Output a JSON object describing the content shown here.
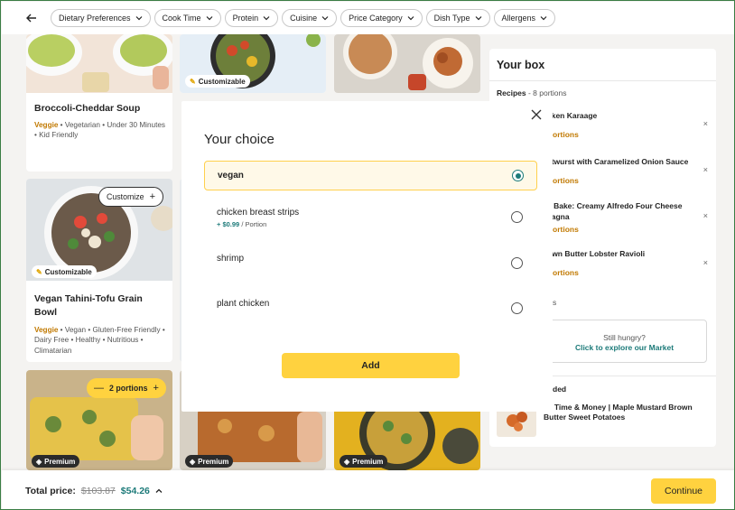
{
  "filters": [
    "Dietary Preferences",
    "Cook Time",
    "Protein",
    "Cuisine",
    "Price Category",
    "Dish Type",
    "Allergens"
  ],
  "cards": {
    "broccoli": {
      "title": "Broccoli-Cheddar Soup",
      "veggie": "Veggie",
      "tags_rest": "Vegetarian • Under 30 Minutes • Kid Friendly"
    },
    "tofu": {
      "title": "Vegan Tahini-Tofu Grain Bowl",
      "veggie": "Veggie",
      "tags_rest": "Vegan • Gluten-Free Friendly • Dairy Free • Healthy • Nutritious • Climatarian",
      "customize_label": "Customize",
      "badge": "Customizable"
    },
    "stir_fry_badge": "Customizable",
    "portions_label": "2 portions",
    "premium_label": "Premium"
  },
  "box": {
    "title": "Your box",
    "recipes_label": "Recipes",
    "recipes_count": "- 8 portions",
    "items": [
      {
        "name": "cken Karaage",
        "portions": "ortions"
      },
      {
        "name": "atwurst with Caramelized Onion Sauce",
        "portions": "ortions"
      },
      {
        "name": "y Bake: Creamy Alfredo Four Cheese\nsagna",
        "portions": "ortions"
      },
      {
        "name": "own Butter Lobster Ravioli",
        "portions": "ortions"
      }
    ],
    "partial_s": "s",
    "remove_icon": "×",
    "hungry_title": "Still hungry?",
    "hungry_link": "Click to explore our Market",
    "added_label": "ded",
    "addon_name": "ve Time & Money | Maple Mustard Brown Butter Sweet Potatoes"
  },
  "modal": {
    "title": "Your choice",
    "options": [
      {
        "label": "vegan",
        "price": "",
        "unit": "",
        "selected": true
      },
      {
        "label": "chicken breast strips",
        "price": "+ $0.99",
        "unit": " / Portion",
        "selected": false
      },
      {
        "label": "shrimp",
        "price": "",
        "unit": "",
        "selected": false
      },
      {
        "label": "plant chicken",
        "price": "",
        "unit": "",
        "selected": false
      }
    ],
    "add_label": "Add"
  },
  "footer": {
    "total_label": "Total price:",
    "old_price": "$103.87",
    "new_price": "$54.26",
    "continue_label": "Continue"
  },
  "colors": {
    "accent": "#ffd23f",
    "teal": "#1c7a79",
    "veggie": "#c17900"
  },
  "icons": {
    "back": "back-arrow-icon",
    "chevron": "chevron-down-icon",
    "close": "close-icon",
    "plus": "plus-icon",
    "minus": "minus-icon",
    "diamond": "diamond-icon",
    "sparkle": "sparkle-icon"
  }
}
